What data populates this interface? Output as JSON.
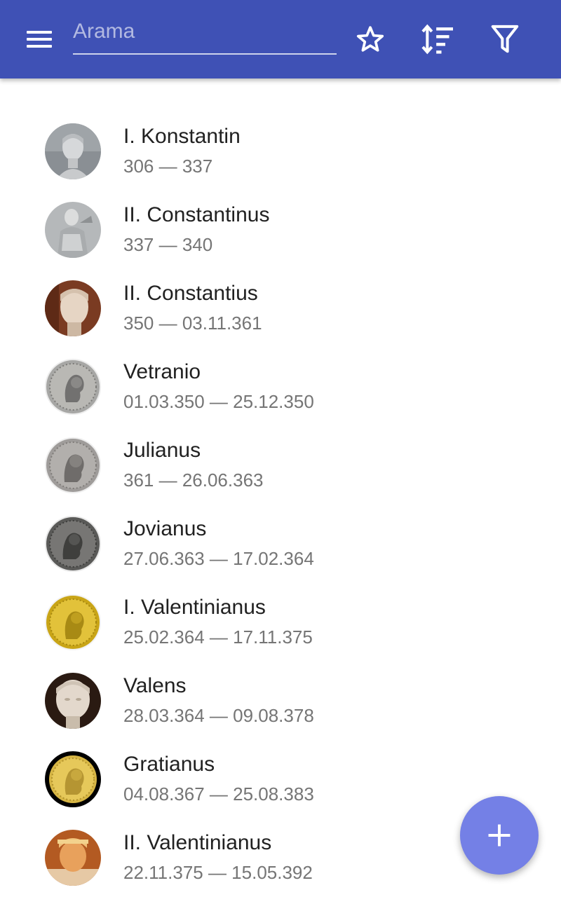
{
  "appbar": {
    "menu_icon": "hamburger-menu-icon",
    "search_placeholder": "Arama",
    "search_value": "",
    "actions": [
      {
        "icon": "star-outline-icon"
      },
      {
        "icon": "sort-icon"
      },
      {
        "icon": "filter-icon"
      }
    ],
    "color": "#3f51b5"
  },
  "emperors": [
    {
      "name": "I. Konstantin",
      "reign": "306 — 337",
      "image": "marble-bust-portrait"
    },
    {
      "name": "II. Constantinus",
      "reign": "337 — 340",
      "image": "marble-statue-portrait"
    },
    {
      "name": "II. Constantius",
      "reign": "350 — 03.11.361",
      "image": "marble-head-portrait"
    },
    {
      "name": "Vetranio",
      "reign": "01.03.350 — 25.12.350",
      "image": "silver-coin-portrait"
    },
    {
      "name": "Julianus",
      "reign": "361 — 26.06.363",
      "image": "silver-coin-portrait"
    },
    {
      "name": "Jovianus",
      "reign": "27.06.363 — 17.02.364",
      "image": "bronze-coin-portrait"
    },
    {
      "name": "I. Valentinianus",
      "reign": "25.02.364 — 17.11.375",
      "image": "gold-coin-portrait"
    },
    {
      "name": "Valens",
      "reign": "28.03.364 — 09.08.378",
      "image": "marble-head-portrait"
    },
    {
      "name": "Gratianus",
      "reign": "04.08.367 — 25.08.383",
      "image": "gold-coin-portrait"
    },
    {
      "name": "II. Valentinianus",
      "reign": "22.11.375 — 15.05.392",
      "image": "bronze-head-portrait"
    }
  ],
  "fab": {
    "icon": "plus-icon",
    "color": "#7480e6"
  }
}
